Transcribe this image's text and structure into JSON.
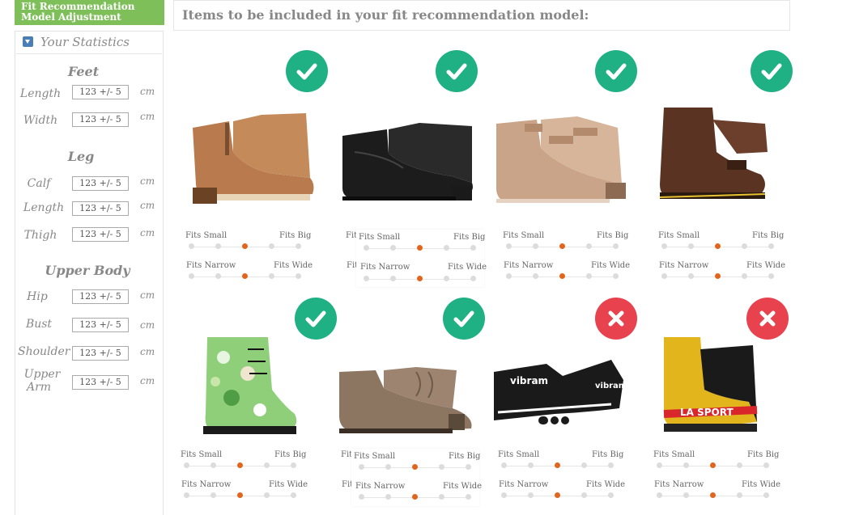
{
  "panel": {
    "header_line1": "Fit Recommendation",
    "header_line2": "Model Adjustment",
    "stats_title": "Your Statistics",
    "unit": "cm",
    "sections": {
      "feet": "Feet",
      "leg": "Leg",
      "upper": "Upper Body"
    },
    "fields": {
      "foot_length": {
        "label": "Length",
        "value": "123 +/- 5"
      },
      "foot_width": {
        "label": "Width",
        "value": "123 +/- 5"
      },
      "calf": {
        "label": "Calf",
        "value": "123 +/- 5"
      },
      "leg_length": {
        "label": "Length",
        "value": "123 +/- 5"
      },
      "thigh": {
        "label": "Thigh",
        "value": "123 +/- 5"
      },
      "hip": {
        "label": "Hip",
        "value": "123 +/- 5"
      },
      "bust": {
        "label": "Bust",
        "value": "123 +/- 5"
      },
      "shoulder": {
        "label": "Shoulder",
        "value": "123 +/- 5"
      },
      "upper_arm_1": {
        "label": "Upper",
        "value": "123 +/- 5"
      },
      "upper_arm_2": {
        "label": "Arm"
      }
    }
  },
  "main": {
    "title": "Items to be included in your fit recommendation model:"
  },
  "sliders": {
    "fits_small": "Fits Small",
    "fits_big": "Fits Big",
    "fits_narrow": "Fits Narrow",
    "fits_wide": "Fits Wide",
    "partial_small": "Fit",
    "partial_narrow": "Fit"
  },
  "items": [
    {
      "included": true,
      "size_level": 0.5,
      "width_level": 0.5,
      "color": "#b97a4e"
    },
    {
      "included": true,
      "size_level": 0.5,
      "width_level": 0.5,
      "color": "#1c1c1c"
    },
    {
      "included": true,
      "size_level": 0.5,
      "width_level": 0.5,
      "color": "#caa488"
    },
    {
      "included": true,
      "size_level": 0.5,
      "width_level": 0.5,
      "color": "#5a3322"
    },
    {
      "included": true,
      "size_level": 0.5,
      "width_level": 0.5,
      "color": "#8fcf7a"
    },
    {
      "included": true,
      "size_level": 0.5,
      "width_level": 0.5,
      "color": "#8c7561"
    },
    {
      "included": false,
      "size_level": 0.5,
      "width_level": 0.5,
      "color": "#1a1a1a"
    },
    {
      "included": false,
      "size_level": 0.5,
      "width_level": 0.5,
      "color": "#e2b51c"
    }
  ],
  "shoe_text": {
    "vibram_1": "vibram",
    "vibram_2": "vibram",
    "la_sportiva": "LA SPORT"
  },
  "colors": {
    "header": "#7fbf5a",
    "check": "#1fb184",
    "cross": "#e8424f",
    "selected_dot": "#e2651e"
  }
}
